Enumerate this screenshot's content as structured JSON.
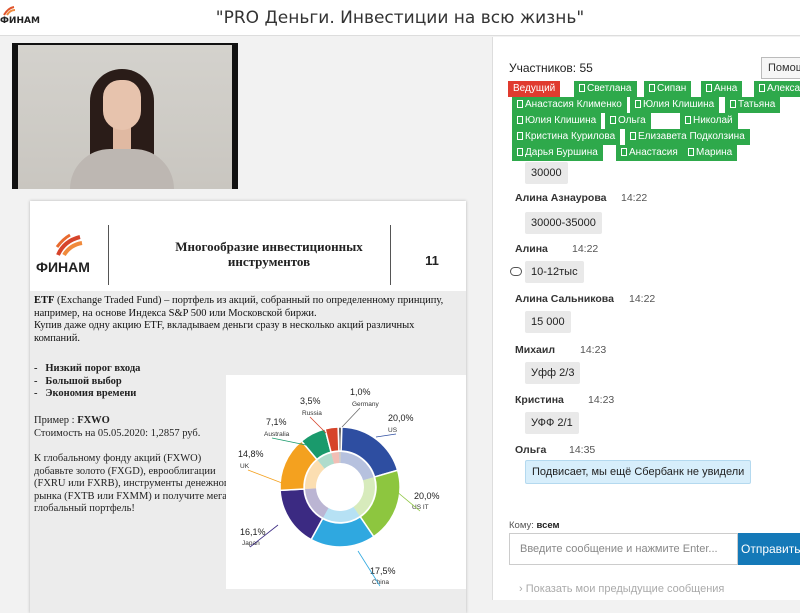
{
  "header": {
    "title": "\"PRO Деньги. Инвестиции на всю жизнь\"",
    "logo_text": "ФИНАМ"
  },
  "slide": {
    "logo_text": "ФИНАМ",
    "title": "Многообразие инвестиционных инструментов",
    "number": "11",
    "etf_term": "ETF",
    "etf_text": " (Exchange Traded Fund) – портфель из акций, собранный по определенному принципу, например, на основе Индекса S&P 500 или Московской биржи.",
    "etf_text2": "Купив даже одну акцию ETF, вкладываем деньги сразу в несколько акций различных компаний.",
    "bullets": [
      "Низкий порог входа",
      "Большой выбор",
      "Экономия времени"
    ],
    "example_label": "Пример : ",
    "example_ticker": "FXWO",
    "example_price": "Стоимость на 05.05.2020: 1,2857 руб.",
    "gold_text": "К глобальному фонду акций (FXWO) добавьте золото (FXGD), еврооблигации (FXRU или FXRB), инструменты денежного рынка (FXTB или FXMM) и получите мега-глобальный портфель!"
  },
  "chart_data": {
    "type": "pie",
    "categories": [
      "US",
      "US IT",
      "China",
      "Japan",
      "UK",
      "Australia",
      "Russia",
      "Germany"
    ],
    "values": [
      20.0,
      20.0,
      17.5,
      16.1,
      14.8,
      7.1,
      3.5,
      1.0
    ],
    "labels": [
      "20,0%",
      "20,0%",
      "17,5%",
      "16,1%",
      "14,8%",
      "7,1%",
      "3,5%",
      "1,0%"
    ],
    "colors": [
      "#2e4ea1",
      "#8dc63f",
      "#2fa8e0",
      "#3b2a82",
      "#f4a11f",
      "#1a9a6c",
      "#d6442a",
      "#6b6b6b"
    ]
  },
  "chat": {
    "participants_label": "Участников: 55",
    "help_label": "Помощь",
    "tags": [
      {
        "label": "Ведущий",
        "host": true
      },
      {
        "label": "Светлана",
        "host": false
      },
      {
        "label": "Сипан",
        "host": false
      },
      {
        "label": "Анна",
        "host": false
      },
      {
        "label": "Александр",
        "host": false
      },
      {
        "label": "Анастасия Клименко",
        "host": false
      },
      {
        "label": "Юлия Клишина",
        "host": false
      },
      {
        "label": "Татьяна",
        "host": false
      },
      {
        "label": "Юлия Клишина",
        "host": false
      },
      {
        "label": "Ольга",
        "host": false
      },
      {
        "label": "Николай",
        "host": false
      },
      {
        "label": "Кристина Курилова",
        "host": false
      },
      {
        "label": "Елизавета Подколзина",
        "host": false
      },
      {
        "label": "Дарья Буршина",
        "host": false
      },
      {
        "label": "Анастасия",
        "host": false
      },
      {
        "label": "Марина",
        "host": false
      }
    ],
    "messages": [
      {
        "author": "",
        "time": "",
        "text": "30000"
      },
      {
        "author": "Алина Азнаурова",
        "time": "14:22",
        "text": "30000-35000"
      },
      {
        "author": "Алина",
        "time": "14:22",
        "text": "10-12тыс"
      },
      {
        "author": "Алина Сальникова",
        "time": "14:22",
        "text": "15 000"
      },
      {
        "author": "Михаил",
        "time": "14:23",
        "text": "Уфф 2/3"
      },
      {
        "author": "Кристина",
        "time": "14:23",
        "text": "УФФ 2/1"
      },
      {
        "author": "Ольга",
        "time": "14:35",
        "text": "Подвисает, мы ещё Сбербанк не увидели"
      }
    ],
    "to_label": "Кому:",
    "to_value": "всем",
    "input_placeholder": "Введите сообщение и нажмите Enter...",
    "send_label": "Отправить",
    "prev_label": "Показать мои предыдущие сообщения"
  }
}
